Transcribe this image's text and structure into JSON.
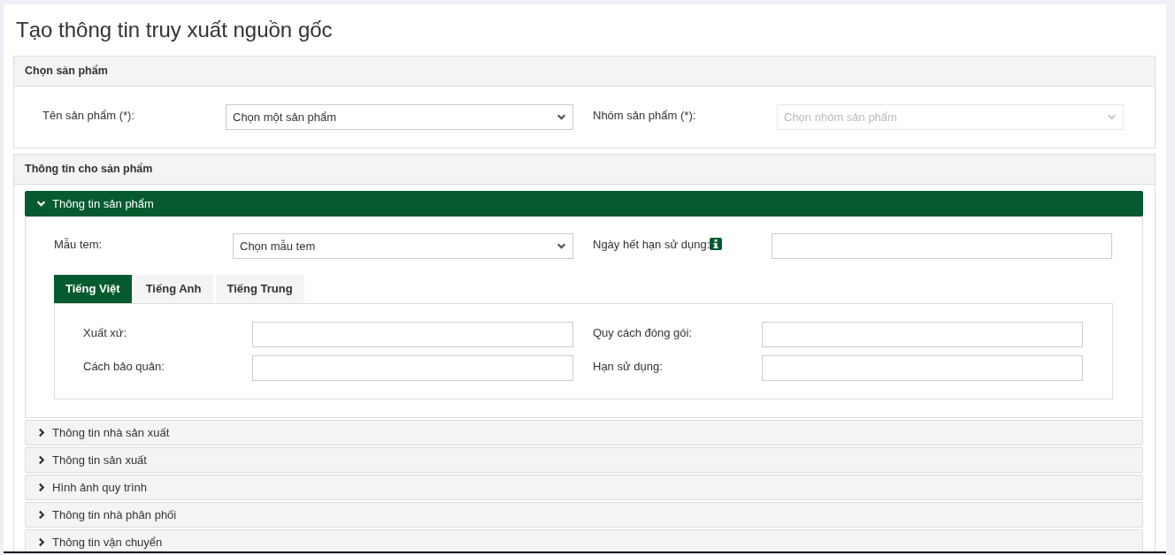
{
  "page_title": "Tạo thông tin truy xuất nguồn gốc",
  "select_product": {
    "title": "Chọn sản phẩm",
    "fields": [
      {
        "label": "Tên sản phẩm (*):",
        "kind": "select",
        "value": "Chọn một sản phẩm",
        "disabled": false
      },
      {
        "label": "Nhóm sản phẩm (*):",
        "kind": "select",
        "value": "Chọn nhóm sản phẩm",
        "disabled": true
      }
    ]
  },
  "product_info": {
    "title": "Thông tin cho sản phẩm",
    "sections": [
      {
        "title": "Thông tin sản phẩm",
        "expanded": true,
        "fields": [
          {
            "label": "Mẫu tem:",
            "kind": "select",
            "value": "Chọn mẫu tem",
            "disabled": false
          },
          {
            "label": "Ngày hết hạn sử dụng:",
            "kind": "text",
            "info_icon": true
          }
        ],
        "tabs": [
          {
            "label": "Tiếng Việt",
            "selected": true
          },
          {
            "label": "Tiếng Anh",
            "selected": false
          },
          {
            "label": "Tiếng Trung",
            "selected": false
          }
        ],
        "tab_fields": [
          {
            "label": "Xuất xứ:",
            "kind": "text"
          },
          {
            "label": "Quy cách đóng gói:",
            "kind": "text"
          },
          {
            "label": "Cách bảo quản:",
            "kind": "text"
          },
          {
            "label": "Hạn sử dụng:",
            "kind": "text"
          }
        ]
      },
      {
        "title": "Thông tin nhà sản xuất",
        "expanded": false
      },
      {
        "title": "Thông tin sản xuất",
        "expanded": false
      },
      {
        "title": "Hình ảnh quy trình",
        "expanded": false
      },
      {
        "title": "Thông tin nhà phân phối",
        "expanded": false
      },
      {
        "title": "Thông tin vận chuyển",
        "expanded": false
      }
    ]
  }
}
